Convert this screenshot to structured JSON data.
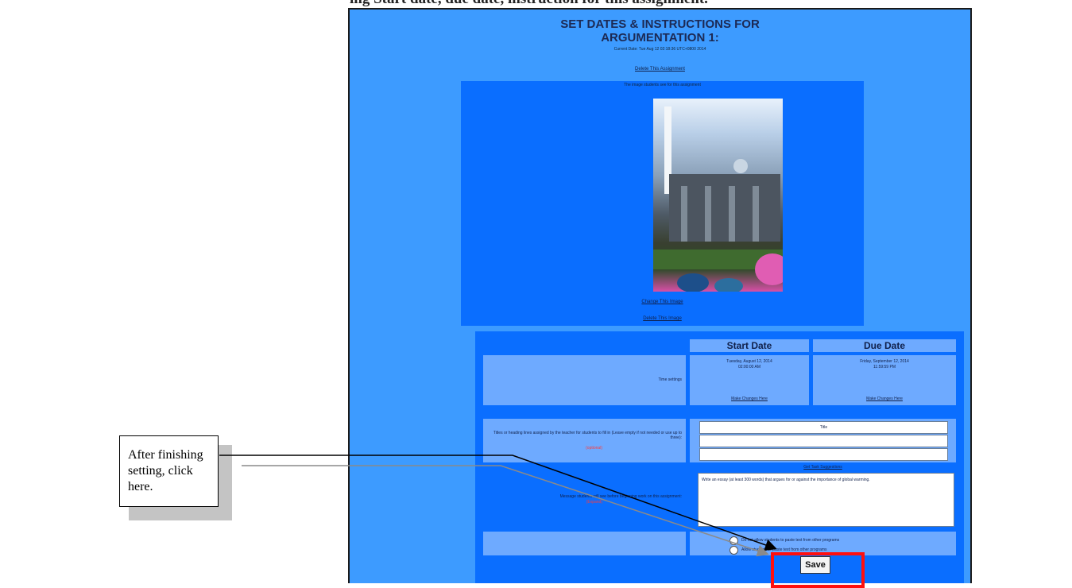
{
  "document": {
    "heading_fragment": "ing Start date, due date, instruction for this assignment."
  },
  "app": {
    "title_line1": "SET DATES & INSTRUCTIONS FOR",
    "title_line2": "ARGUMENTATION 1:",
    "current_date": "Current Date: Tue Aug 12 02:18:36 UTC+0800 2014",
    "delete_assignment": "Delete This Assignment",
    "image_caption": "The image students see for this assignment",
    "change_image": "Change This Image",
    "delete_image": "Delete This Image"
  },
  "dates": {
    "start_header": "Start Date",
    "due_header": "Due Date",
    "time_settings_label": "Time settings",
    "start_value_line1": "Tuesday, August 12, 2014",
    "start_value_line2": "02:00:00 AM",
    "due_value_line1": "Friday, September 12, 2014",
    "due_value_line2": "11:59:59 PM",
    "make_changes": "Make Changes Here"
  },
  "titles": {
    "label": "Titles or heading lines assigned by the teacher for students to fill in (Leave empty if not needed or use up to three):",
    "optional": "(optional)",
    "column_header": "Title",
    "rows": [
      "",
      ""
    ]
  },
  "instructions": {
    "suggestions_link": "Get Task Suggestions",
    "label": "Message students will see before beginning work on this assignment:",
    "optional": "(Expand)",
    "text": "Write an essay (at least 300 words) that argues for or against the importance of global warming."
  },
  "paste_options": {
    "option1": "Do not allow students to paste text from other programs",
    "option2": "Allow students to paste text from other programs"
  },
  "save_label": "Save",
  "callout": {
    "text": "After finishing setting, click here."
  },
  "colors": {
    "panel_bg": "#3d9bff",
    "inner_bg": "#0a6eff",
    "cell_bg": "#6eaaff",
    "highlight": "#ff0f0f"
  }
}
